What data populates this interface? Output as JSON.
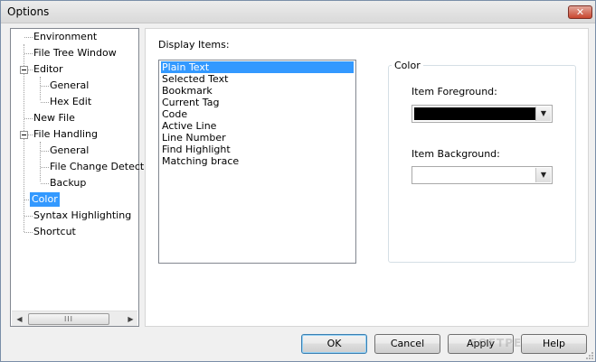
{
  "window": {
    "title": "Options",
    "close_glyph": "✕"
  },
  "tree": {
    "items": [
      {
        "label": "Environment",
        "level": 0
      },
      {
        "label": "File Tree Window",
        "level": 0
      },
      {
        "label": "Editor",
        "level": 0,
        "expanded": true
      },
      {
        "label": "General",
        "level": 1
      },
      {
        "label": "Hex Edit",
        "level": 1
      },
      {
        "label": "New File",
        "level": 0
      },
      {
        "label": "File Handling",
        "level": 0,
        "expanded": true
      },
      {
        "label": "General",
        "level": 1
      },
      {
        "label": "File Change Detect",
        "level": 1
      },
      {
        "label": "Backup",
        "level": 1
      },
      {
        "label": "Color",
        "level": 0,
        "selected": true
      },
      {
        "label": "Syntax Highlighting",
        "level": 0
      },
      {
        "label": "Shortcut",
        "level": 0
      }
    ],
    "scroll_left": "◀",
    "scroll_right": "▶",
    "scroll_thumb_grip": "III"
  },
  "display": {
    "label": "Display Items:",
    "items": [
      "Plain Text",
      "Selected Text",
      "Bookmark",
      "Current Tag",
      "Code",
      "Active Line",
      "Line Number",
      "Find Highlight",
      "Matching brace"
    ],
    "selected_index": 0
  },
  "color_group": {
    "title": "Color",
    "foreground_label": "Item Foreground:",
    "foreground_color": "#000000",
    "background_label": "Item Background:",
    "background_color": "#ffffff",
    "dropdown_glyph": "▼"
  },
  "buttons": {
    "ok": "OK",
    "cancel": "Cancel",
    "apply": "Apply",
    "help": "Help"
  },
  "watermark": "SOFTPEDIA",
  "colors": {
    "selection": "#3399ff",
    "window_bg": "#f0f0f0"
  }
}
